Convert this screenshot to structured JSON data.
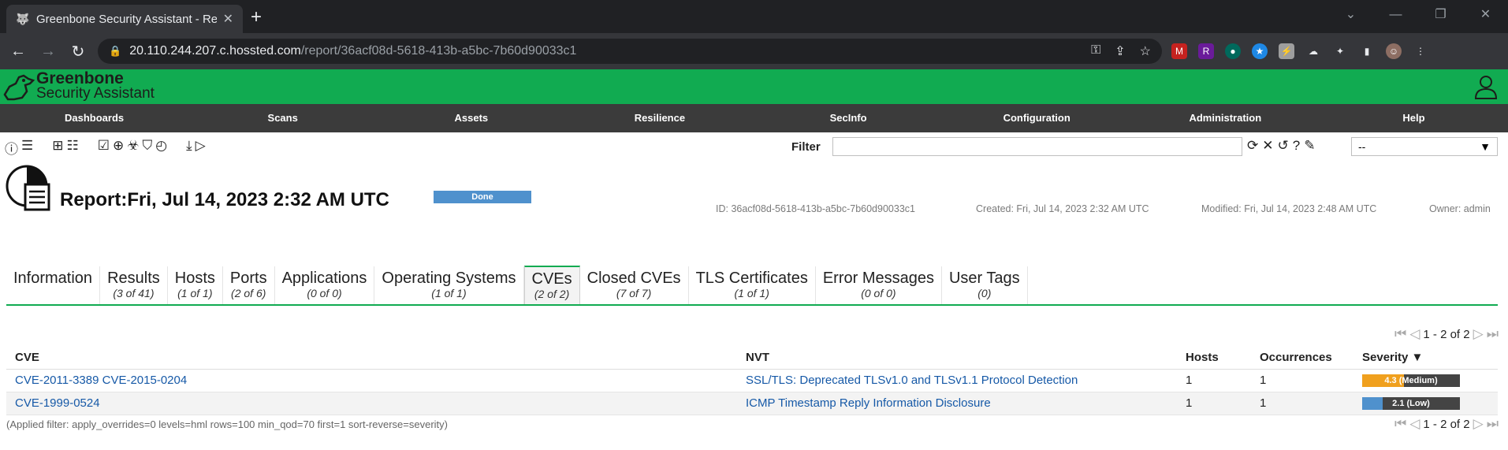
{
  "browser": {
    "tab_title": "Greenbone Security Assistant - Re",
    "url_host": "20.110.244.207.c.hossted.com",
    "url_path": "/report/36acf08d-5618-413b-a5bc-7b60d90033c1"
  },
  "app": {
    "logo_line1": "Greenbone",
    "logo_line2": "Security Assistant",
    "brand_color": "#11ab51"
  },
  "menu": [
    "Dashboards",
    "Scans",
    "Assets",
    "Resilience",
    "SecInfo",
    "Configuration",
    "Administration",
    "Help"
  ],
  "filter": {
    "label": "Filter",
    "value": "",
    "select_value": "--"
  },
  "report": {
    "title": "Report:Fri, Jul 14, 2023 2:32 AM UTC",
    "status": "Done",
    "id": "ID: 36acf08d-5618-413b-a5bc-7b60d90033c1",
    "created": "Created: Fri, Jul 14, 2023 2:32 AM UTC",
    "modified": "Modified: Fri, Jul 14, 2023 2:48 AM UTC",
    "owner": "Owner: admin"
  },
  "tabs": [
    {
      "name": "Information",
      "count": ""
    },
    {
      "name": "Results",
      "count": "(3 of 41)"
    },
    {
      "name": "Hosts",
      "count": "(1 of 1)"
    },
    {
      "name": "Ports",
      "count": "(2 of 6)"
    },
    {
      "name": "Applications",
      "count": "(0 of 0)"
    },
    {
      "name": "Operating Systems",
      "count": "(1 of 1)"
    },
    {
      "name": "CVEs",
      "count": "(2 of 2)"
    },
    {
      "name": "Closed CVEs",
      "count": "(7 of 7)"
    },
    {
      "name": "TLS Certificates",
      "count": "(1 of 1)"
    },
    {
      "name": "Error Messages",
      "count": "(0 of 0)"
    },
    {
      "name": "User Tags",
      "count": "(0)"
    }
  ],
  "pager": {
    "text": "1 - 2 of 2"
  },
  "table": {
    "headers": {
      "cve": "CVE",
      "nvt": "NVT",
      "hosts": "Hosts",
      "occurrences": "Occurrences",
      "severity": "Severity ▼"
    },
    "rows": [
      {
        "cve": "CVE-2011-3389 CVE-2015-0204",
        "nvt": "SSL/TLS: Deprecated TLSv1.0 and TLSv1.1 Protocol Detection",
        "hosts": "1",
        "occurrences": "1",
        "severity": "4.3 (Medium)",
        "severity_value": 4.3,
        "severity_color": "#f0a01e"
      },
      {
        "cve": "CVE-1999-0524",
        "nvt": "ICMP Timestamp Reply Information Disclosure",
        "hosts": "1",
        "occurrences": "1",
        "severity": "2.1 (Low)",
        "severity_value": 2.1,
        "severity_color": "#4f91cd"
      }
    ]
  },
  "applied_filter": "(Applied filter: apply_overrides=0 levels=hml rows=100 min_qod=70 first=1 sort-reverse=severity)"
}
